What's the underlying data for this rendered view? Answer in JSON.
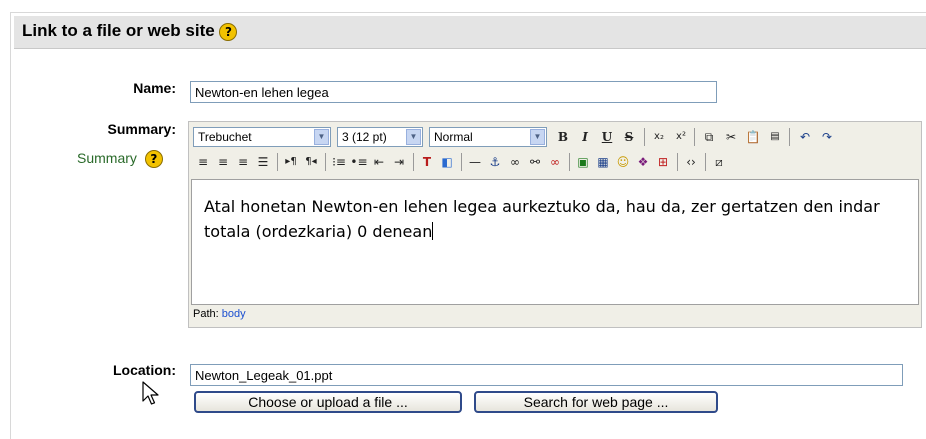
{
  "section": {
    "title": "Link to a file or web site"
  },
  "name": {
    "label": "Name:",
    "value": "Newton-en lehen legea"
  },
  "summary": {
    "label": "Summary:",
    "sublabel": "Summary",
    "font_family": "Trebuchet",
    "font_size": "3 (12 pt)",
    "format": "Normal",
    "toolbar_row1": [
      "B",
      "I",
      "U",
      "S",
      "x₂",
      "x²",
      "copy",
      "cut",
      "paste",
      "paste-word",
      "undo",
      "redo"
    ],
    "toolbar_row2": [
      "align-left",
      "align-center",
      "align-right",
      "justify",
      "ltr",
      "rtl",
      "ordered-list",
      "unordered-list",
      "outdent",
      "indent",
      "text-color",
      "bg-color",
      "hr",
      "anchor",
      "link",
      "unlink",
      "nolink",
      "image",
      "table",
      "smiley",
      "special-char",
      "search-replace",
      "html-source",
      "fullscreen"
    ],
    "content": "Atal honetan Newton-en lehen legea aurkeztuko da, hau da, zer gertatzen den indar totala (ordezkaria) 0 denean",
    "path_label": "Path:",
    "path_value": "body"
  },
  "location": {
    "label": "Location:",
    "value": "Newton_Legeak_01.ppt",
    "choose_button": "Choose or upload a file ...",
    "search_button": "Search for web page ..."
  }
}
